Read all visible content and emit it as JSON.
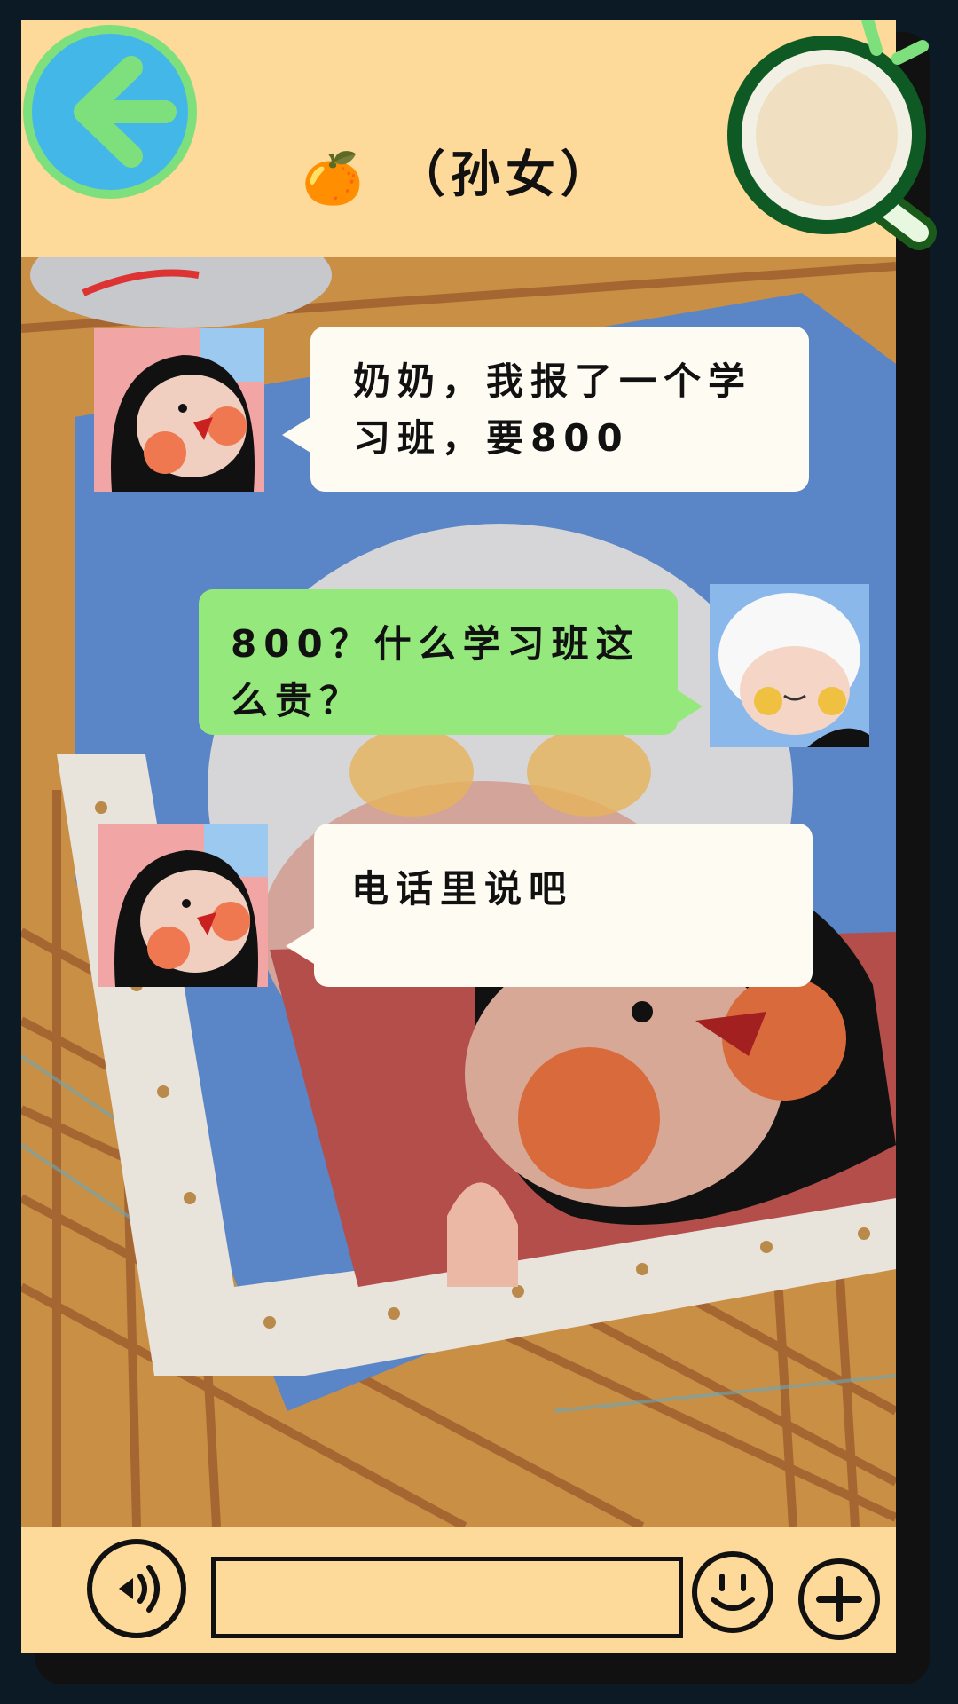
{
  "header": {
    "title_emoji": "🍊",
    "title": "（孙女）"
  },
  "colors": {
    "header_bg": "#fdd99a",
    "back_button": "#43b8e8",
    "back_arrow": "#7ee07c",
    "left_bubble": "#fdfbf2",
    "right_bubble": "#95e87c",
    "frame": "#111111"
  },
  "icons": {
    "back": "back-arrow-icon",
    "search": "magnifier-icon",
    "voice": "voice-icon",
    "emoji": "smiley-icon",
    "plus": "plus-icon"
  },
  "messages": [
    {
      "sender": "granddaughter",
      "side": "left",
      "line1": "奶奶，我报了一个学",
      "line2": "习班，要800"
    },
    {
      "sender": "grandma",
      "side": "right",
      "line1": "800？什么学习班这",
      "line2": "么贵？"
    },
    {
      "sender": "granddaughter",
      "side": "left",
      "line1": "电话里说吧",
      "line2": ""
    }
  ],
  "input": {
    "value": ""
  }
}
